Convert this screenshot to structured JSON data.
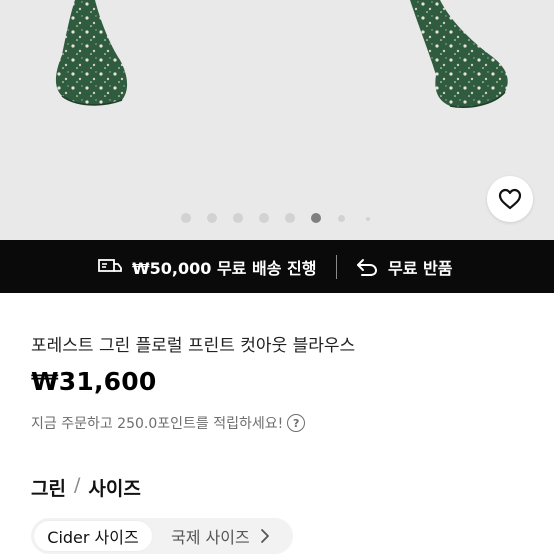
{
  "product": {
    "title": "포레스트 그린 플로럴 프린트 컷아웃 블라우스",
    "price": "₩31,600",
    "points_text": "지금 주문하고 250.0포인트를 적립하세요!"
  },
  "promo": {
    "free_shipping": "₩50,000 무료 배송 진행",
    "free_returns": "무료 반품"
  },
  "options": {
    "color": "그린",
    "separator": "/",
    "size_label": "사이즈"
  },
  "size_tabs": {
    "cider": "Cider 사이즈",
    "international": "국제 사이즈"
  },
  "gallery": {
    "slide_count": 8,
    "active_index": 5
  },
  "colors": {
    "promo_bg": "#0a0a0a",
    "image_bg": "#e9e9e9",
    "fabric": "#2e5a3d"
  },
  "icons": {
    "wishlist": "heart-icon",
    "shipping": "truck-icon",
    "returns": "return-arrow-icon",
    "help": "question-icon",
    "next": "chevron-right-icon"
  }
}
